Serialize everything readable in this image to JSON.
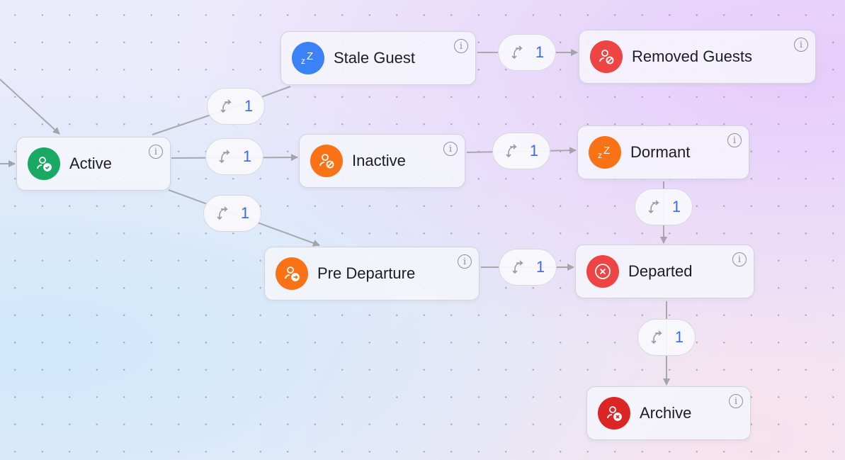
{
  "nodes": {
    "active": {
      "label": "Active",
      "icon": "user-check-icon",
      "color": "#1aa865"
    },
    "stale_guest": {
      "label": "Stale Guest",
      "icon": "sleep-zz-icon",
      "color": "#3b82f6"
    },
    "removed_guests": {
      "label": "Removed Guests",
      "icon": "user-blocked-icon",
      "color": "#ef4444"
    },
    "inactive": {
      "label": "Inactive",
      "icon": "user-blocked-icon",
      "color": "#f97316"
    },
    "dormant": {
      "label": "Dormant",
      "icon": "sleep-zz-icon",
      "color": "#f97316"
    },
    "pre_departure": {
      "label": "Pre Departure",
      "icon": "user-arrow-icon",
      "color": "#f97316"
    },
    "departed": {
      "label": "Departed",
      "icon": "circle-x-icon",
      "color": "#ef4444"
    },
    "archive": {
      "label": "Archive",
      "icon": "user-x-icon",
      "color": "#dc2626"
    }
  },
  "info_glyph": "i",
  "transitions": [
    {
      "from": "Active",
      "to": "Stale Guest",
      "count": "1"
    },
    {
      "from": "Active",
      "to": "Inactive",
      "count": "1"
    },
    {
      "from": "Active",
      "to": "Pre Departure",
      "count": "1"
    },
    {
      "from": "Stale Guest",
      "to": "Removed Guests",
      "count": "1"
    },
    {
      "from": "Inactive",
      "to": "Dormant",
      "count": "1"
    },
    {
      "from": "Dormant",
      "to": "Departed",
      "count": "1"
    },
    {
      "from": "Pre Departure",
      "to": "Departed",
      "count": "1"
    },
    {
      "from": "Departed",
      "to": "Archive",
      "count": "1"
    }
  ]
}
